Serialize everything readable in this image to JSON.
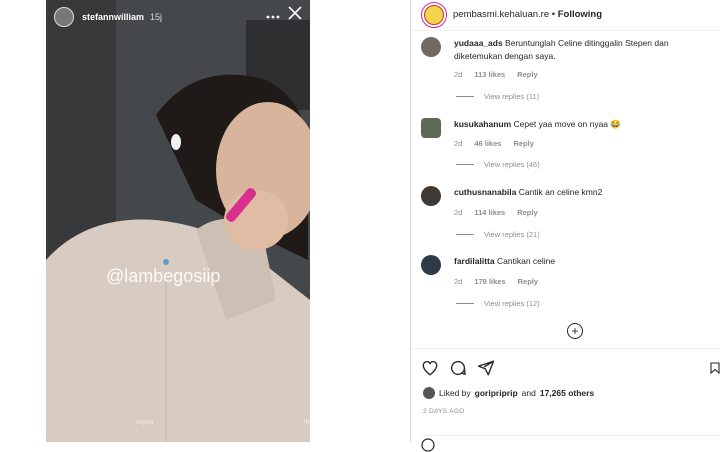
{
  "story": {
    "username": "stefannwilliam",
    "time": "15j",
    "menu_icon": "dots-icon",
    "close_icon": "close-icon",
    "watermark": "@lambegosiip",
    "bottom_left": "imysm",
    "bottom_right": "tgs"
  },
  "post": {
    "username": "pembasmi.kehaluan.re",
    "separator": "•",
    "following": "Following"
  },
  "comments": [
    {
      "user": "yudaaa_ads",
      "text": "Beruntunglah Celine ditinggalin Stepen dan diketemukan dengan saya.",
      "age": "2d",
      "likes": "113 likes",
      "reply": "Reply",
      "view_replies": "View replies (11)"
    },
    {
      "user": "kusukahanum",
      "text": "Cepet yaa move on nyaa 😂",
      "age": "2d",
      "likes": "46 likes",
      "reply": "Reply",
      "view_replies": "View replies (46)"
    },
    {
      "user": "cuthusnanabila",
      "text": "Cantik an celine kmn2",
      "age": "2d",
      "likes": "114 likes",
      "reply": "Reply",
      "view_replies": "View replies (21)"
    },
    {
      "user": "fardilalitta",
      "text": "Cantikan celine",
      "age": "2d",
      "likes": "179 likes",
      "reply": "Reply",
      "view_replies": "View replies (12)"
    }
  ],
  "actions": {
    "liked_by_prefix": "Liked by",
    "liked_by_user": "goripriprip",
    "liked_by_and": "and",
    "liked_by_count": "17,265 others",
    "date": "2 DAYS AGO"
  },
  "colors": {
    "gradient_ring": "#d6249f",
    "meta_gray": "#8e8e8e",
    "text": "#262626"
  }
}
